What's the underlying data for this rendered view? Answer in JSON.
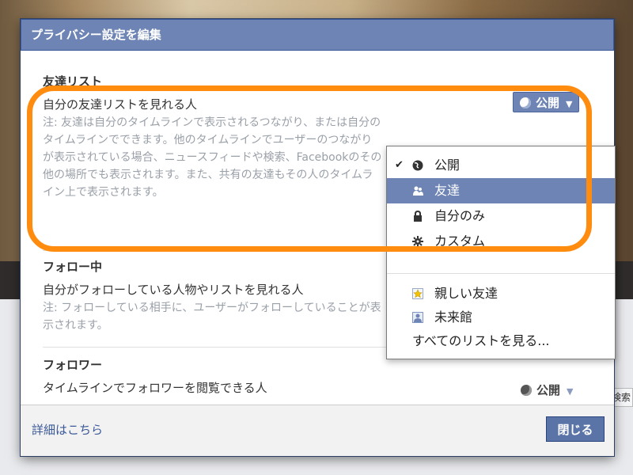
{
  "dialog": {
    "title": "プライバシー設定を編集",
    "footer_link": "詳細はこちら",
    "close_label": "閉じる"
  },
  "sections": [
    {
      "title": "友達リスト",
      "subtitle": "自分の友達リストを見れる人",
      "note": "注: 友達は自分のタイムラインで表示されるつながり、または自分のタイムラインでできます。他のタイムラインでユーザーのつながりが表示されている場合、ニュースフィードや検索、Facebookのその他の場所でも表示されます。また、共有の友達もその人のタイムライン上で表示されます。",
      "privacy": "公開"
    },
    {
      "title": "フォロー中",
      "subtitle": "自分がフォローしている人物やリストを見れる人",
      "note": "注: フォローしている相手に、ユーザーがフォローしていることが表示されます。"
    },
    {
      "title": "フォロワー",
      "subtitle": "タイムラインでフォロワーを閲覧できる人",
      "privacy": "公開"
    }
  ],
  "menu": {
    "items": [
      {
        "label": "公開",
        "icon": "globe-icon",
        "checked": true
      },
      {
        "label": "友達",
        "icon": "friends-icon",
        "highlighted": true
      },
      {
        "label": "自分のみ",
        "icon": "lock-icon"
      },
      {
        "label": "カスタム",
        "icon": "gear-icon"
      }
    ],
    "lists": [
      {
        "label": "親しい友達",
        "icon": "star-list-icon"
      },
      {
        "label": "未来館",
        "icon": "person-list-icon"
      }
    ],
    "see_all": "すべてのリストを見る..."
  },
  "colors": {
    "header_blue": "#6d84b4",
    "highlight_orange": "#ff8b0f",
    "close_button": "#5b74a8"
  }
}
